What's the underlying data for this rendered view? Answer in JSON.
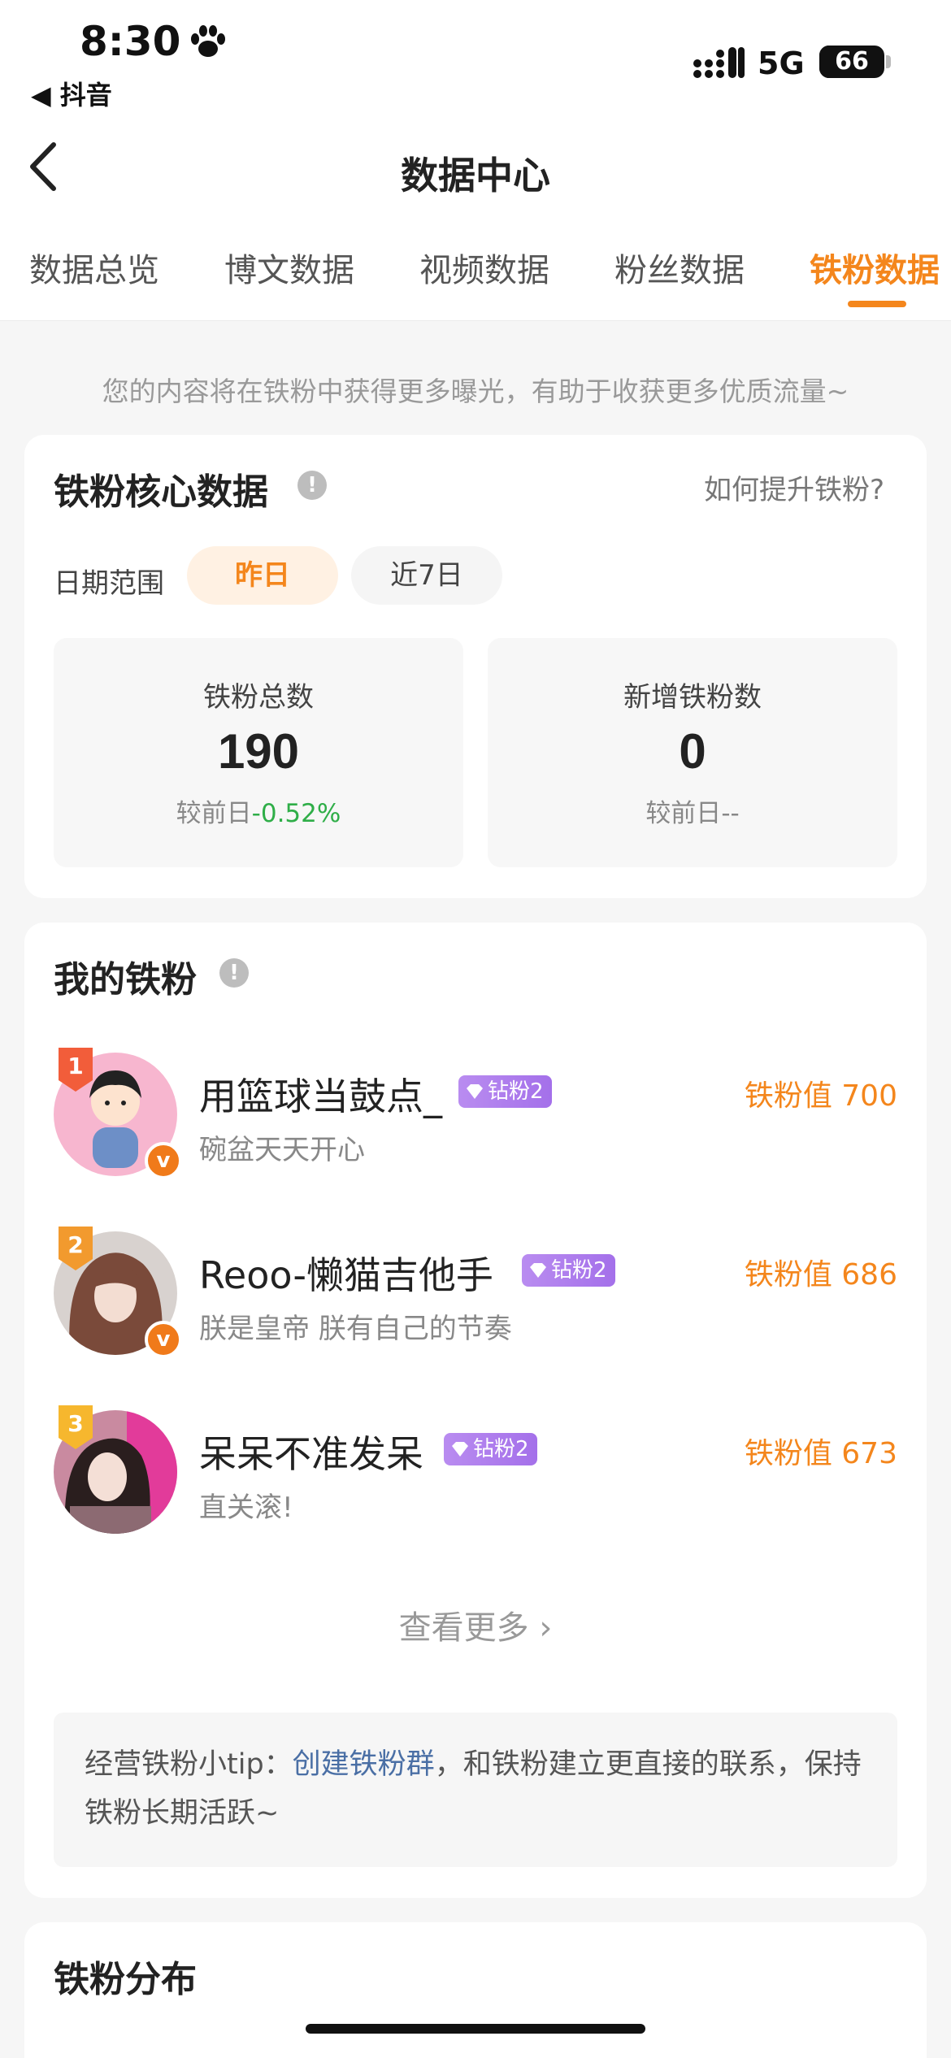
{
  "status_bar": {
    "time": "8:30",
    "back_app": "◀ 抖音",
    "network": "5G",
    "battery": "66",
    "battery_level_percent": 66
  },
  "header": {
    "title": "数据中心"
  },
  "tabs": [
    {
      "label": "数据总览",
      "active": false
    },
    {
      "label": "博文数据",
      "active": false
    },
    {
      "label": "视频数据",
      "active": false
    },
    {
      "label": "粉丝数据",
      "active": false
    },
    {
      "label": "铁粉数据",
      "active": true
    }
  ],
  "intro": "您的内容将在铁粉中获得更多曝光，有助于收获更多优质流量~",
  "core": {
    "title": "铁粉核心数据",
    "help_link": "如何提升铁粉?",
    "date_label": "日期范围",
    "date_options": [
      "昨日",
      "近7日"
    ],
    "selected_date": "昨日",
    "stats": [
      {
        "label": "铁粉总数",
        "value": "190",
        "compare_prefix": "较前日",
        "compare_value": "-0.52%"
      },
      {
        "label": "新增铁粉数",
        "value": "0",
        "compare_prefix": "较前日",
        "compare_value": "--"
      }
    ]
  },
  "fans": {
    "title": "我的铁粉",
    "list": [
      {
        "rank": "1",
        "name": "用篮球当鼓点_",
        "tag": "钻粉2",
        "desc": "碗盆天天开心",
        "score": "铁粉值 700",
        "verified": true
      },
      {
        "rank": "2",
        "name": "Reoo-懒猫吉他手",
        "tag": "钻粉2",
        "desc": "朕是皇帝 朕有自己的节奏",
        "score": "铁粉值 686",
        "verified": true
      },
      {
        "rank": "3",
        "name": "呆呆不准发呆",
        "tag": "钻粉2",
        "desc": "直关滚!",
        "score": "铁粉值 673",
        "verified": false
      }
    ],
    "more": "查看更多",
    "tip_prefix": "经营铁粉小tip：",
    "tip_link": "创建铁粉群",
    "tip_suffix": "，和铁粉建立更直接的联系，保持铁粉长期活跃~"
  },
  "distribution": {
    "title": "铁粉分布"
  },
  "colors": {
    "accent": "#f4861c",
    "negative_change": "#2fae48",
    "tag_purple": "#a470ea",
    "link": "#4a6fa5"
  }
}
